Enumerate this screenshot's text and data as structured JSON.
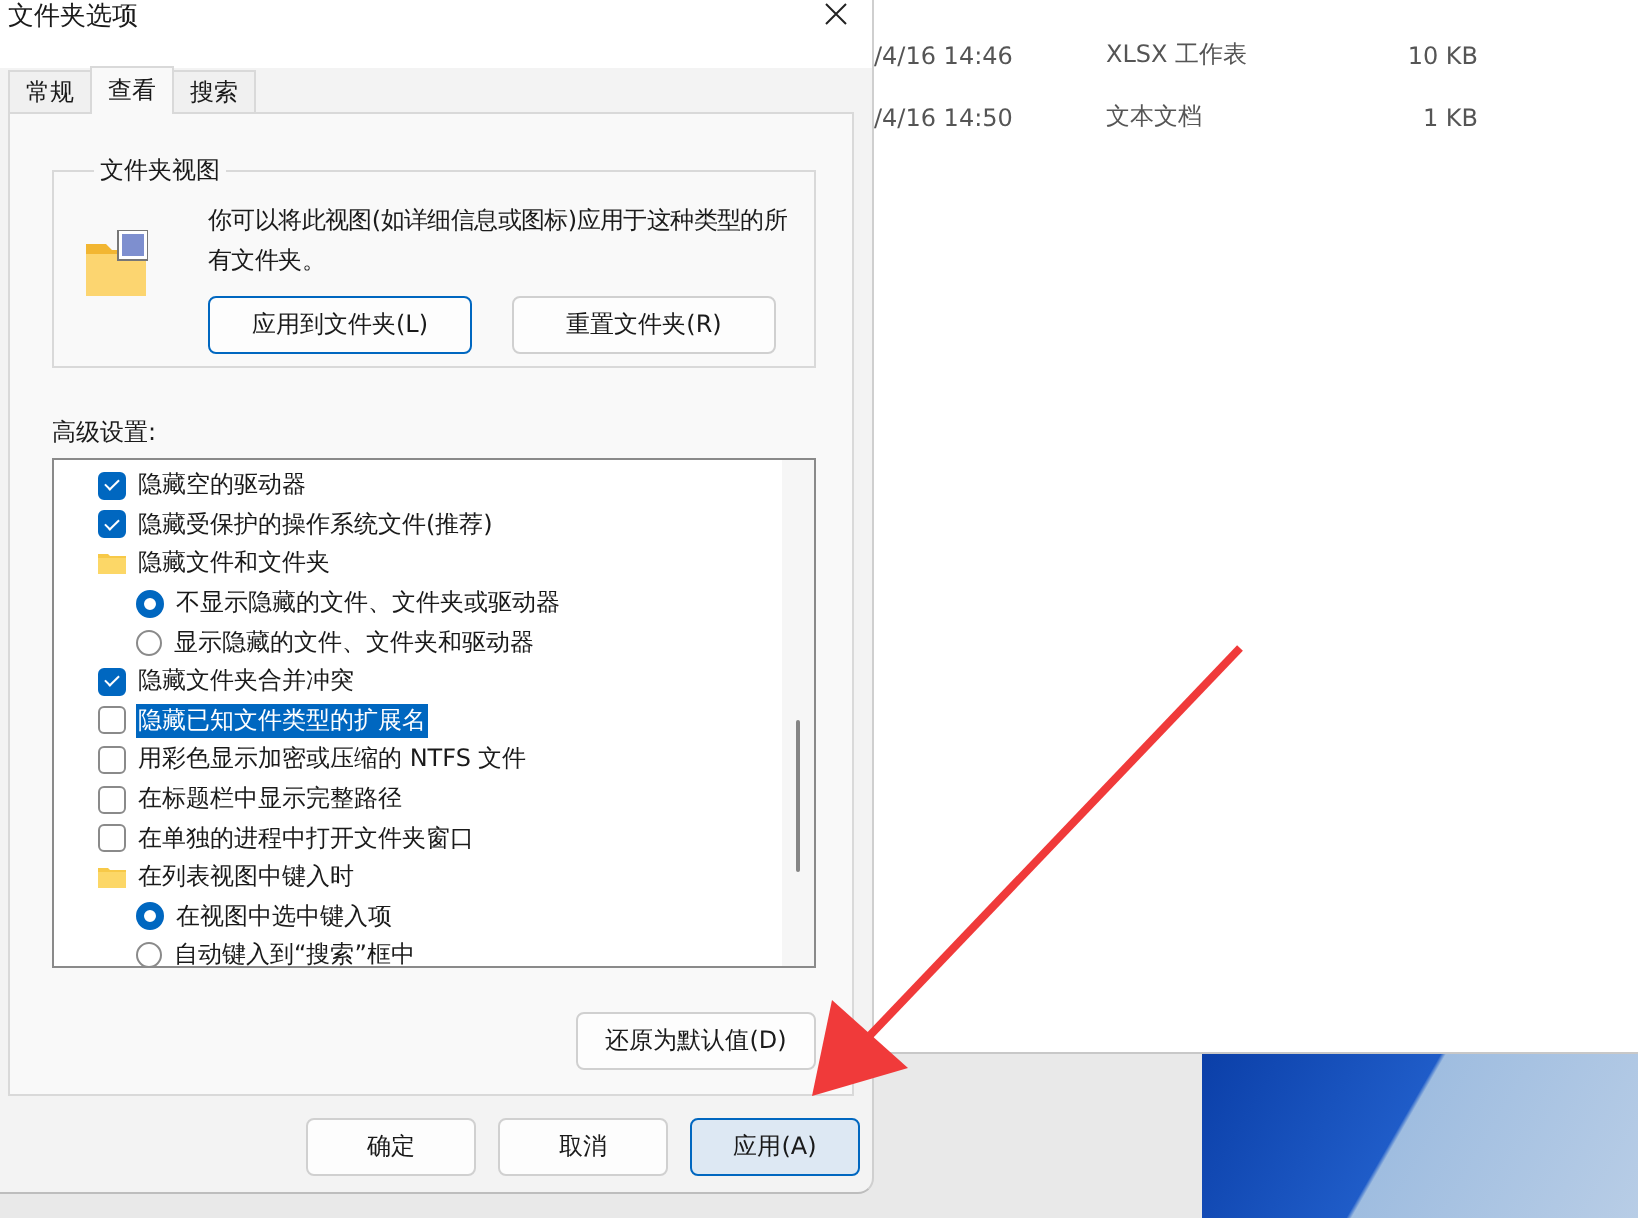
{
  "dialog": {
    "title": "文件夹选项",
    "tabs": [
      {
        "label": "常规",
        "selected": false
      },
      {
        "label": "查看",
        "selected": true
      },
      {
        "label": "搜索",
        "selected": false
      }
    ],
    "folder_view": {
      "legend": "文件夹视图",
      "description": "你可以将此视图(如详细信息或图标)应用于这种类型的所有文件夹。",
      "buttons": [
        {
          "label": "应用到文件夹(L)",
          "focused": true
        },
        {
          "label": "重置文件夹(R)",
          "focused": false
        }
      ]
    },
    "advanced": {
      "label": "高级设置:",
      "items": [
        {
          "kind": "checkbox",
          "label": "隐藏空的驱动器",
          "checked": true,
          "selected": false
        },
        {
          "kind": "checkbox",
          "label": "隐藏受保护的操作系统文件(推荐)",
          "checked": true,
          "selected": false
        },
        {
          "kind": "folder",
          "label": "隐藏文件和文件夹",
          "selected": false
        },
        {
          "kind": "radio",
          "label": "不显示隐藏的文件、文件夹或驱动器",
          "checked": true,
          "selected": false
        },
        {
          "kind": "radio",
          "label": "显示隐藏的文件、文件夹和驱动器",
          "checked": false,
          "selected": false
        },
        {
          "kind": "checkbox",
          "label": "隐藏文件夹合并冲突",
          "checked": true,
          "selected": false
        },
        {
          "kind": "checkbox",
          "label": "隐藏已知文件类型的扩展名",
          "checked": false,
          "selected": true
        },
        {
          "kind": "checkbox",
          "label": "用彩色显示加密或压缩的 NTFS 文件",
          "checked": false,
          "selected": false
        },
        {
          "kind": "checkbox",
          "label": "在标题栏中显示完整路径",
          "checked": false,
          "selected": false
        },
        {
          "kind": "checkbox",
          "label": "在单独的进程中打开文件夹窗口",
          "checked": false,
          "selected": false
        },
        {
          "kind": "folder",
          "label": "在列表视图中键入时",
          "selected": false
        },
        {
          "kind": "radio",
          "label": "在视图中选中键入项",
          "checked": true,
          "selected": false
        },
        {
          "kind": "radio",
          "label": "自动键入到“搜索”框中",
          "checked": false,
          "selected": false
        }
      ],
      "restore_button": "还原为默认值(D)"
    },
    "footer_buttons": [
      {
        "label": "确定",
        "focused": false
      },
      {
        "label": "取消",
        "focused": false
      },
      {
        "label": "应用(A)",
        "focused": true
      }
    ]
  },
  "explorer": {
    "files": [
      {
        "modified": "/4/16 14:46",
        "type": "XLSX 工作表",
        "size": "10 KB"
      },
      {
        "modified": "/4/16 14:50",
        "type": "文本文档",
        "size": "1 KB"
      }
    ]
  }
}
